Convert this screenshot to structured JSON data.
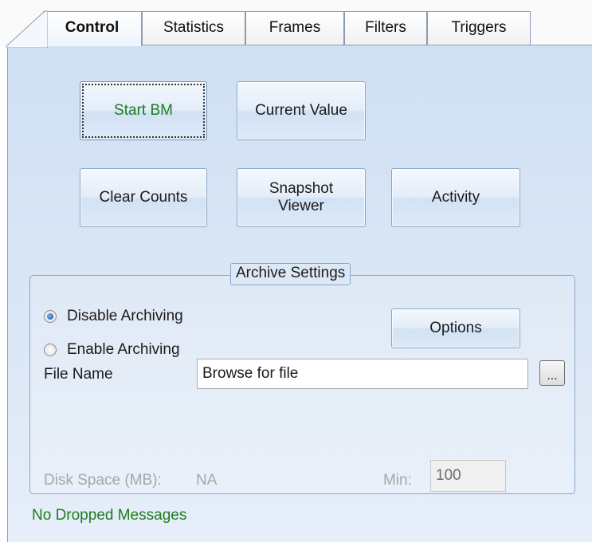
{
  "tabs": [
    {
      "label": "Control",
      "active": true
    },
    {
      "label": "Statistics",
      "active": false
    },
    {
      "label": "Frames",
      "active": false
    },
    {
      "label": "Filters",
      "active": false
    },
    {
      "label": "Triggers",
      "active": false
    }
  ],
  "buttons": {
    "start_bm": "Start BM",
    "current_value": "Current Value",
    "clear_counts": "Clear Counts",
    "snapshot_viewer_line1": "Snapshot",
    "snapshot_viewer_line2": "Viewer",
    "activity": "Activity",
    "options": "Options",
    "browse": "..."
  },
  "archive": {
    "title": "Archive Settings",
    "disable_label": "Disable Archiving",
    "enable_label": "Enable Archiving",
    "selected": "Disable Archiving",
    "file_name_label": "File Name",
    "file_name_value": "Browse for file",
    "disk_space_label": "Disk Space (MB):",
    "disk_space_value": "NA",
    "min_label": "Min:",
    "min_value": "100"
  },
  "status": {
    "text": "No Dropped Messages",
    "color": "#1e7d1e"
  },
  "colors": {
    "panel_gradient_top": "#cfe0f3",
    "button_border": "#8aa5c6",
    "start_bm_text": "#1e7d1e"
  }
}
